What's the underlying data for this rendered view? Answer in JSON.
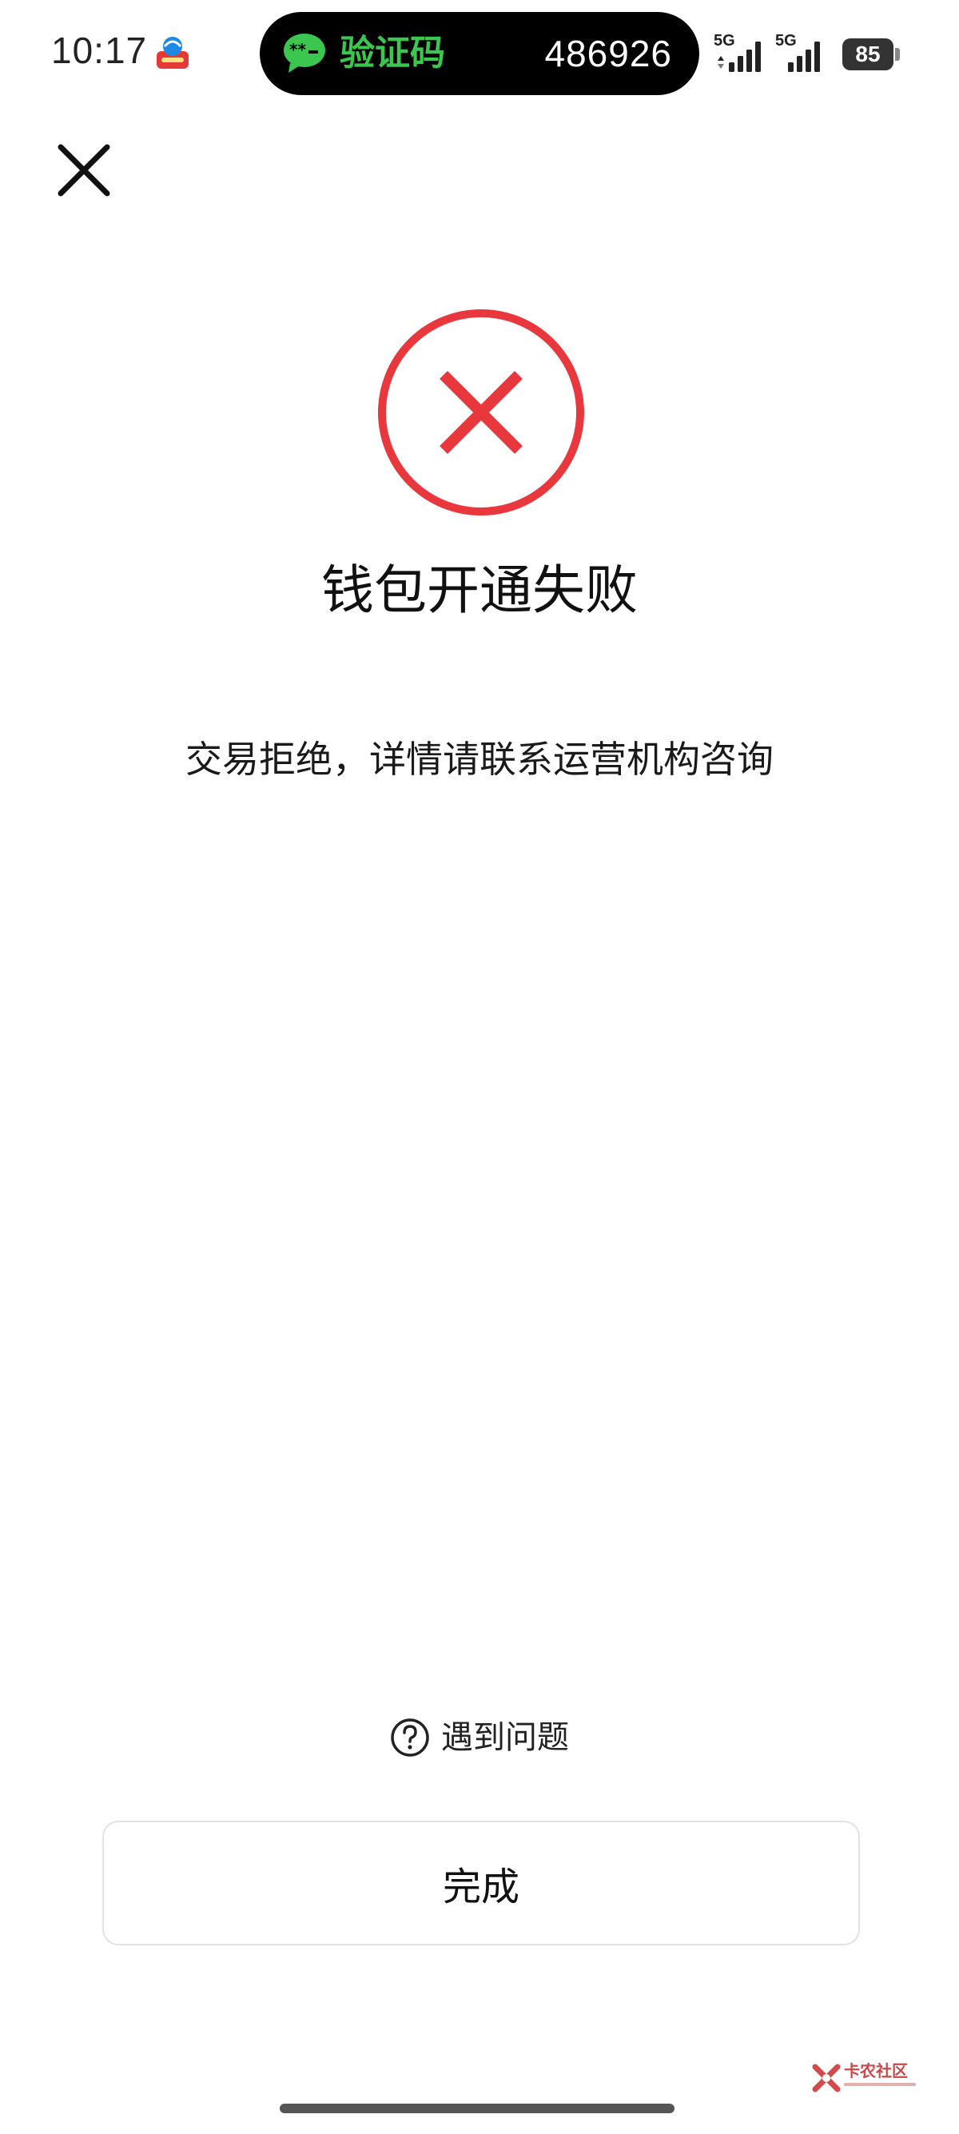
{
  "status_bar": {
    "time": "10:17",
    "carrier_icon": "china-mobile-icon",
    "notification": {
      "app_icon": "wechat-icon",
      "title": "验证码",
      "code": "486926",
      "title_color": "#3ac64f"
    },
    "signal_1_label": "5G",
    "signal_2_label": "5G",
    "battery_level": "85"
  },
  "header": {
    "close_icon": "close-icon"
  },
  "result": {
    "status_icon": "error-x-circle-icon",
    "accent_color": "#e8383d",
    "title": "钱包开通失败",
    "message": "交易拒绝，详情请联系运营机构咨询"
  },
  "footer": {
    "help_icon": "question-circle-icon",
    "help_label": "遇到问题",
    "done_label": "完成"
  },
  "watermark": {
    "label": "卡农社区"
  }
}
